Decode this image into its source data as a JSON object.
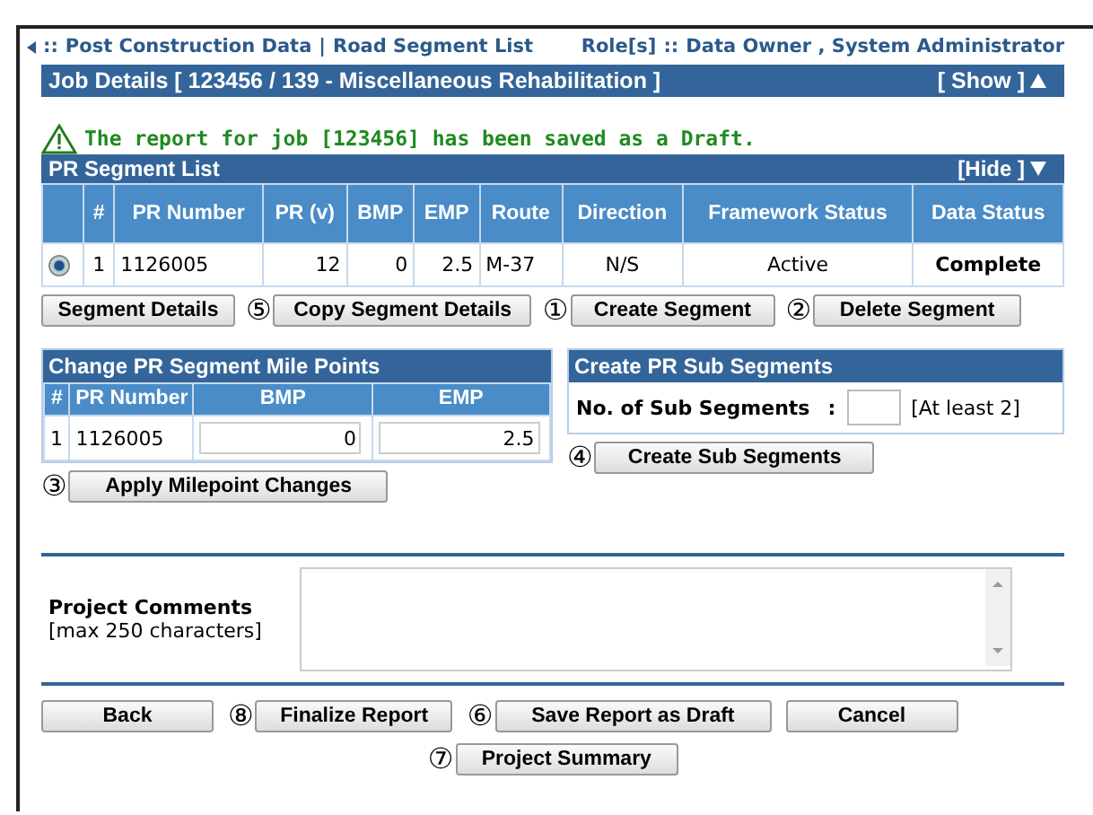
{
  "breadcrumb": {
    "prefix": "::",
    "items": [
      "Post Construction Data",
      "Road Segment List"
    ],
    "separator": "|",
    "roles_label": "Role[s]",
    "roles_separator": "::",
    "roles": "Data Owner ,  System Administrator"
  },
  "job_panel": {
    "title": "Job Details [ 123456 / 139 - Miscellaneous Rehabilitation ]",
    "toggle": "[ Show ]",
    "expanded": false
  },
  "message": {
    "kind": "warning",
    "text": "The report for job [123456] has been saved as a Draft."
  },
  "segment_list": {
    "title": "PR Segment List",
    "toggle": "[Hide  ]",
    "expanded": true,
    "columns": [
      "#",
      "PR Number",
      "PR (v)",
      "BMP",
      "EMP",
      "Route",
      "Direction",
      "Framework Status",
      "Data Status"
    ],
    "rows": [
      {
        "selected": true,
        "cells": [
          "1",
          "1126005",
          "12",
          "0",
          "2.5",
          "M-37",
          "N/S",
          "Active",
          "Complete"
        ]
      }
    ],
    "buttons": [
      {
        "label": "Segment Details"
      },
      {
        "label": "Copy Segment Details",
        "callout": "⑤"
      },
      {
        "label": "Create Segment",
        "callout": "①"
      },
      {
        "label": "Delete Segment",
        "callout": "②"
      }
    ]
  },
  "mile_points": {
    "title": "Change PR Segment Mile Points",
    "columns": [
      "#",
      "PR Number",
      "BMP",
      "EMP"
    ],
    "rows": [
      {
        "number": "1",
        "pr_number": "1126005",
        "bmp": "0",
        "emp": "2.5"
      }
    ],
    "button": {
      "label": "Apply Milepoint Changes",
      "callout": "③"
    }
  },
  "sub_segments": {
    "title": "Create PR Sub Segments",
    "label": "No. of Sub Segments",
    "colon": ":",
    "hint": "[At least 2]",
    "button": {
      "label": "Create Sub Segments",
      "callout": "④"
    }
  },
  "comments": {
    "label": "Project Comments",
    "hint": "[max 250 characters]"
  },
  "footer_buttons": [
    {
      "label": "Back"
    },
    {
      "label": "Finalize Report",
      "callout": "⑧"
    },
    {
      "label": "Save Report as Draft",
      "callout": "⑥"
    },
    {
      "label": "Cancel"
    }
  ],
  "summary_button": {
    "label": "Project Summary",
    "callout": "⑦"
  }
}
